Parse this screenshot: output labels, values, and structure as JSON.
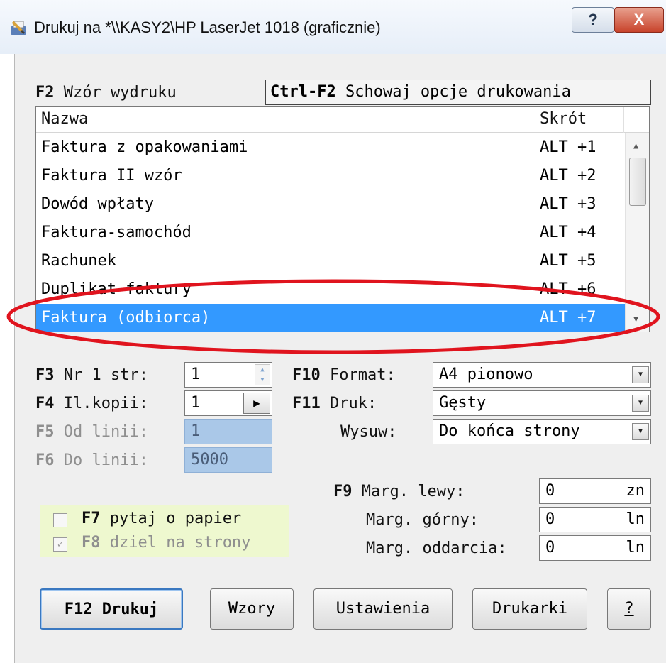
{
  "window": {
    "title": "Drukuj na *\\\\KASY2\\HP LaserJet 1018 (graficznie)",
    "help_label": "?",
    "close_label": "X"
  },
  "template": {
    "key": "F2",
    "label": "Wzór wydruku",
    "hide_key": "Ctrl-F2",
    "hide_label": "Schowaj opcje drukowania"
  },
  "list": {
    "columns": [
      "Nazwa",
      "Skrót"
    ],
    "rows": [
      {
        "name": "Faktura z opakowaniami",
        "shortcut": "ALT +1"
      },
      {
        "name": "Faktura II wzór",
        "shortcut": "ALT +2"
      },
      {
        "name": "Dowód wpłaty",
        "shortcut": "ALT +3"
      },
      {
        "name": "Faktura-samochód",
        "shortcut": "ALT +4"
      },
      {
        "name": "Rachunek",
        "shortcut": "ALT +5"
      },
      {
        "name": "Duplikat faktury",
        "shortcut": "ALT +6"
      },
      {
        "name": "Faktura (odbiorca)",
        "shortcut": "ALT +7"
      }
    ],
    "selected_index": 6,
    "highlight_color": "#3399ff"
  },
  "options": {
    "page_from": {
      "key": "F3",
      "label": "Nr 1 str:",
      "value": "1"
    },
    "copies": {
      "key": "F4",
      "label": "Il.kopii:",
      "value": "1"
    },
    "line_from": {
      "key": "F5",
      "label": "Od linii:",
      "value": "1"
    },
    "line_to": {
      "key": "F6",
      "label": "Do linii:",
      "value": "5000"
    },
    "format": {
      "key": "F10",
      "label": "Format:",
      "value": "A4 pionowo"
    },
    "print": {
      "key": "F11",
      "label": "Druk:",
      "value": "Gęsty"
    },
    "feed": {
      "label": "Wysuw:",
      "value": "Do końca strony"
    }
  },
  "margins": {
    "key": "F9",
    "left": {
      "label": "Marg. lewy:",
      "value": "0",
      "unit": "zn"
    },
    "top": {
      "label": "Marg. górny:",
      "value": "0",
      "unit": "ln"
    },
    "tear": {
      "label": "Marg. oddarcia:",
      "value": "0",
      "unit": "ln"
    }
  },
  "checks": {
    "ask_paper": {
      "key": "F7",
      "label": "pytaj o papier",
      "checked": false
    },
    "split_pages": {
      "key": "F8",
      "label": "dziel na strony",
      "checked": true,
      "disabled": true
    }
  },
  "buttons": {
    "print": "F12 Drukuj",
    "templates": "Wzory",
    "settings": "Ustawienia",
    "printers": "Drukarki",
    "help": "?"
  },
  "colors": {
    "panel": "#efefef",
    "selection": "#3399ff",
    "disabled_field": "#aac8e8",
    "check_panel": "#eef8cf",
    "annotation": "#e0141e"
  }
}
